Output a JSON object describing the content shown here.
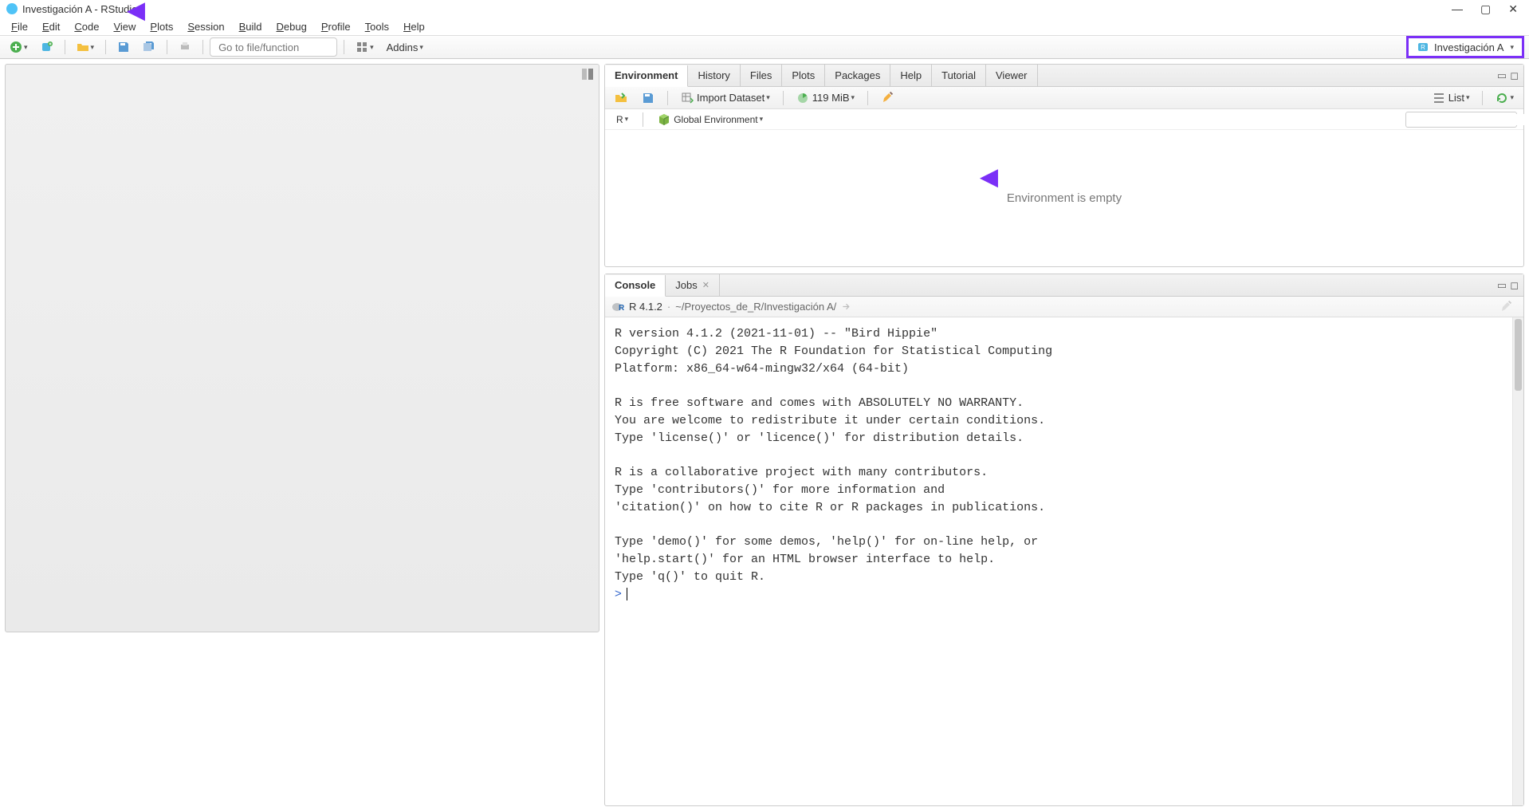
{
  "title": "Investigación A - RStudio",
  "menu": {
    "file": "File",
    "edit": "Edit",
    "code": "Code",
    "view": "View",
    "plots": "Plots",
    "session": "Session",
    "build": "Build",
    "debug": "Debug",
    "profile": "Profile",
    "tools": "Tools",
    "help": "Help"
  },
  "toolbar": {
    "goto_placeholder": "Go to file/function",
    "addins": "Addins",
    "project": "Investigación A"
  },
  "env": {
    "tabs": {
      "environment": "Environment",
      "history": "History",
      "files": "Files",
      "plots": "Plots",
      "packages": "Packages",
      "help": "Help",
      "tutorial": "Tutorial",
      "viewer": "Viewer"
    },
    "import": "Import Dataset",
    "mem": "119 MiB",
    "list": "List",
    "lang": "R",
    "scope": "Global Environment",
    "empty": "Environment is empty"
  },
  "console": {
    "tabs": {
      "console": "Console",
      "jobs": "Jobs"
    },
    "rver": "R 4.1.2",
    "path": "~/Proyectos_de_R/Investigación A/",
    "sep": "·",
    "out": "R version 4.1.2 (2021-11-01) -- \"Bird Hippie\"\nCopyright (C) 2021 The R Foundation for Statistical Computing\nPlatform: x86_64-w64-mingw32/x64 (64-bit)\n\nR is free software and comes with ABSOLUTELY NO WARRANTY.\nYou are welcome to redistribute it under certain conditions.\nType 'license()' or 'licence()' for distribution details.\n\nR is a collaborative project with many contributors.\nType 'contributors()' for more information and\n'citation()' on how to cite R or R packages in publications.\n\nType 'demo()' for some demos, 'help()' for on-line help, or\n'help.start()' for an HTML browser interface to help.\nType 'q()' to quit R.\n",
    "prompt": ">"
  }
}
